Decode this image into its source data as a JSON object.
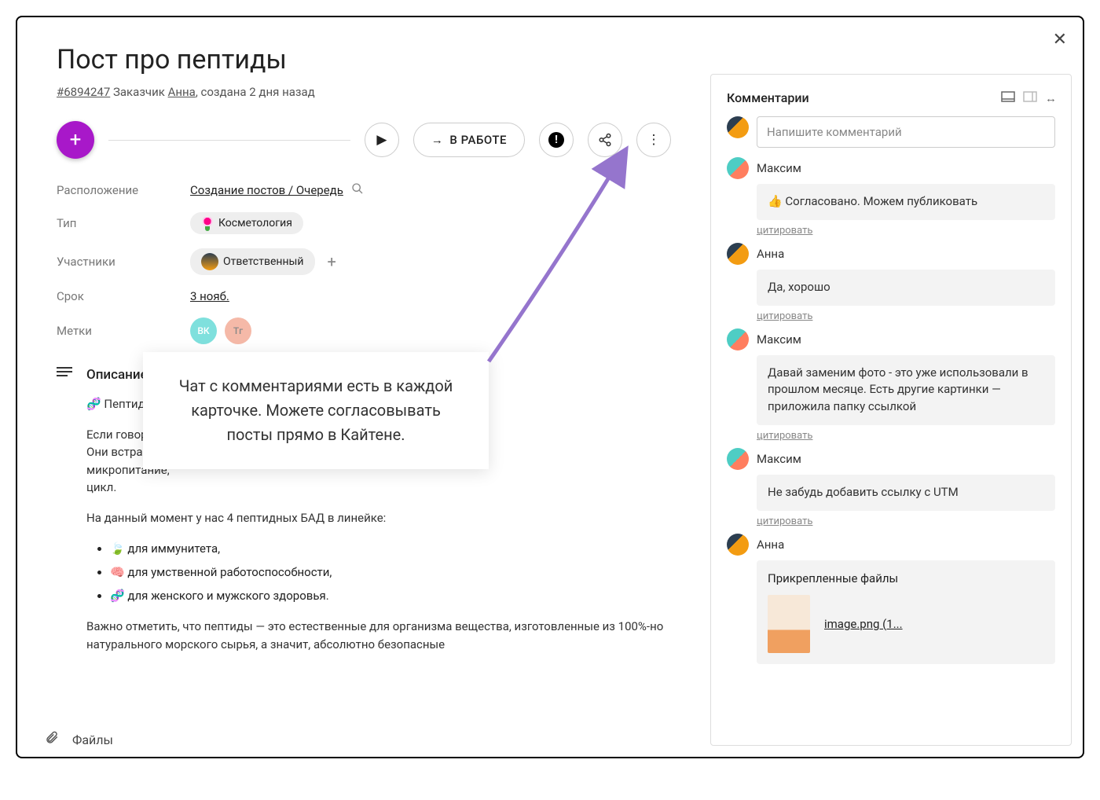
{
  "header": {
    "title": "Пост про пептиды",
    "card_id": "#6894247",
    "customer_label": "Заказчик",
    "customer_name": "Анна",
    "created": ", создана 2 дня назад"
  },
  "actions": {
    "status_label": "В РАБОТЕ"
  },
  "fields": {
    "location_label": "Расположение",
    "location_value": "Создание постов / Очередь",
    "type_label": "Тип",
    "type_value": "Косметология",
    "members_label": "Участники",
    "members_value": "Ответственный",
    "due_label": "Срок",
    "due_value": "3 нояб.",
    "tags_label": "Метки",
    "tag_vk": "ВК",
    "tag_tg": "Tг"
  },
  "desc": {
    "section_label": "Описание",
    "line1": "🧬 Пептиды 🧬",
    "p1": "Если говорить п",
    "p1b": "Они встраивают",
    "p1c": "микропитание,",
    "p1d": "цикл.",
    "p2": "На данный момент у нас 4 пептидных БАД в линейке:",
    "li1": "🍃 для иммунитета,",
    "li2": "🧠 для умственной работоспособности,",
    "li3": "🧬 для женского и мужского здоровья.",
    "p3": "Важно отметить, что пептиды — это естественные для организма вещества, изготовленные из 100%-но натурального морского сырья, а значит, абсолютно безопасные"
  },
  "files_label": "Файлы",
  "overlay_text": "Чат с комментариями есть в каждой карточке. Можете согласовывать посты прямо в Кайтене.",
  "comments": {
    "title": "Комментарии",
    "input_placeholder": "Напишите комментарий",
    "quote_label": "цитировать",
    "attachments_label": "Прикрепленные файлы",
    "attachment_name": "image.png (1...",
    "items": [
      {
        "author": "Максим",
        "avatar": "max",
        "text": "👍 Согласовано. Можем публиковать"
      },
      {
        "author": "Анна",
        "avatar": "anna",
        "text": "Да, хорошо"
      },
      {
        "author": "Максим",
        "avatar": "max",
        "text": "Давай заменим фото - это уже использовали в прошлом месяце. Есть другие картинки — приложила папку ссылкой"
      },
      {
        "author": "Максим",
        "avatar": "max",
        "text": "Не забудь добавить ссылку с UTM"
      }
    ],
    "last_author": "Анна"
  }
}
